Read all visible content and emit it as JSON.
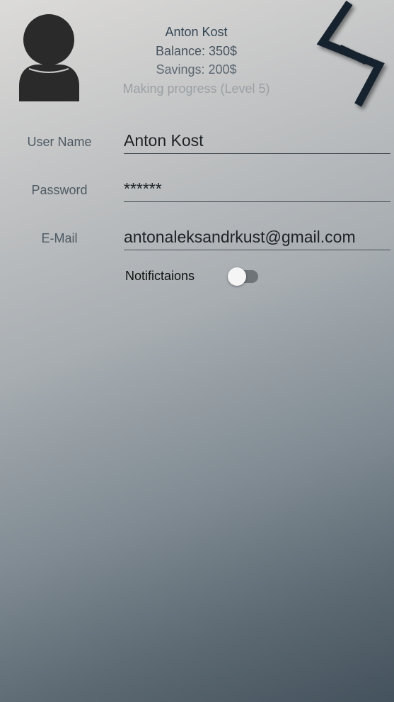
{
  "profile": {
    "name": "Anton Kost",
    "balance": "Balance: 350$",
    "savings": "Savings: 200$",
    "progress": "Making progress (Level 5)"
  },
  "form": {
    "username_label": "User Name",
    "username_value": "Anton Kost",
    "password_label": "Password",
    "password_value": "******",
    "email_label": "E-Mail",
    "email_value": "antonaleksandrkust@gmail.com",
    "notifications_label": "Notifictaions",
    "notifications_enabled": false
  },
  "icons": {
    "avatar": "user-avatar-icon",
    "logo": "app-logo-icon"
  },
  "colors": {
    "logo_dark": "#1b2530",
    "gradient_top": "#dcdbd9",
    "gradient_bottom": "#44525d"
  }
}
